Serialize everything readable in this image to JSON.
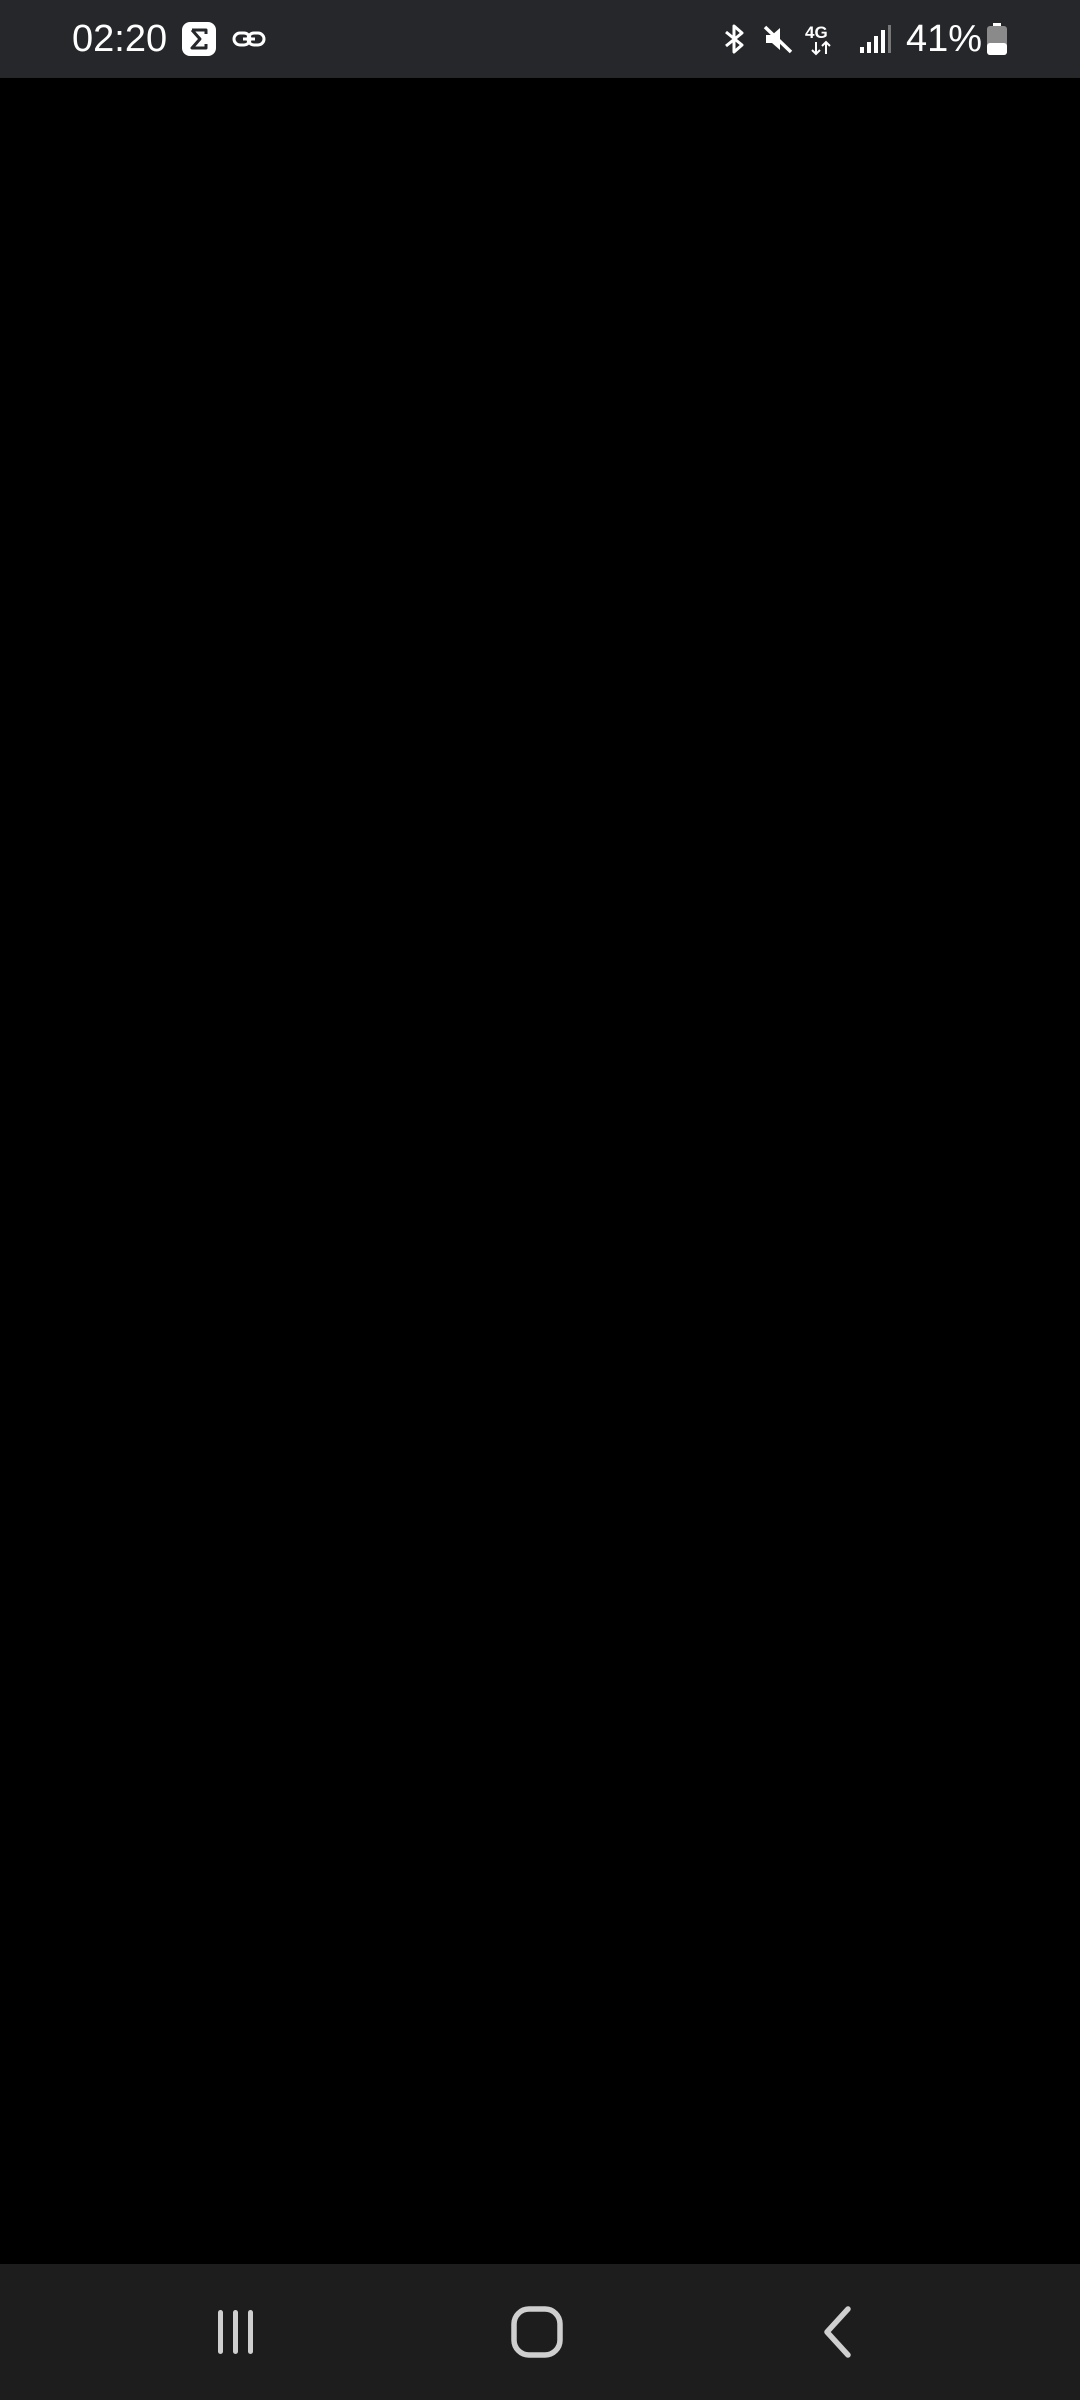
{
  "status_bar": {
    "time": "02:20",
    "battery_percent": "41%",
    "network": "4G",
    "notification_icons": [
      "sigma-app-icon",
      "link-icon"
    ],
    "system_icons": [
      "bluetooth-icon",
      "mute-icon",
      "mobile-data-icon",
      "signal-icon",
      "battery-icon"
    ],
    "battery_level": 0.41,
    "background": "#26272b"
  },
  "content": {
    "background": "#000000"
  },
  "nav_bar": {
    "buttons": [
      "recents-icon",
      "home-icon",
      "back-icon"
    ],
    "background": "#1d1d1d",
    "icon_color": "#cfcfcf"
  }
}
